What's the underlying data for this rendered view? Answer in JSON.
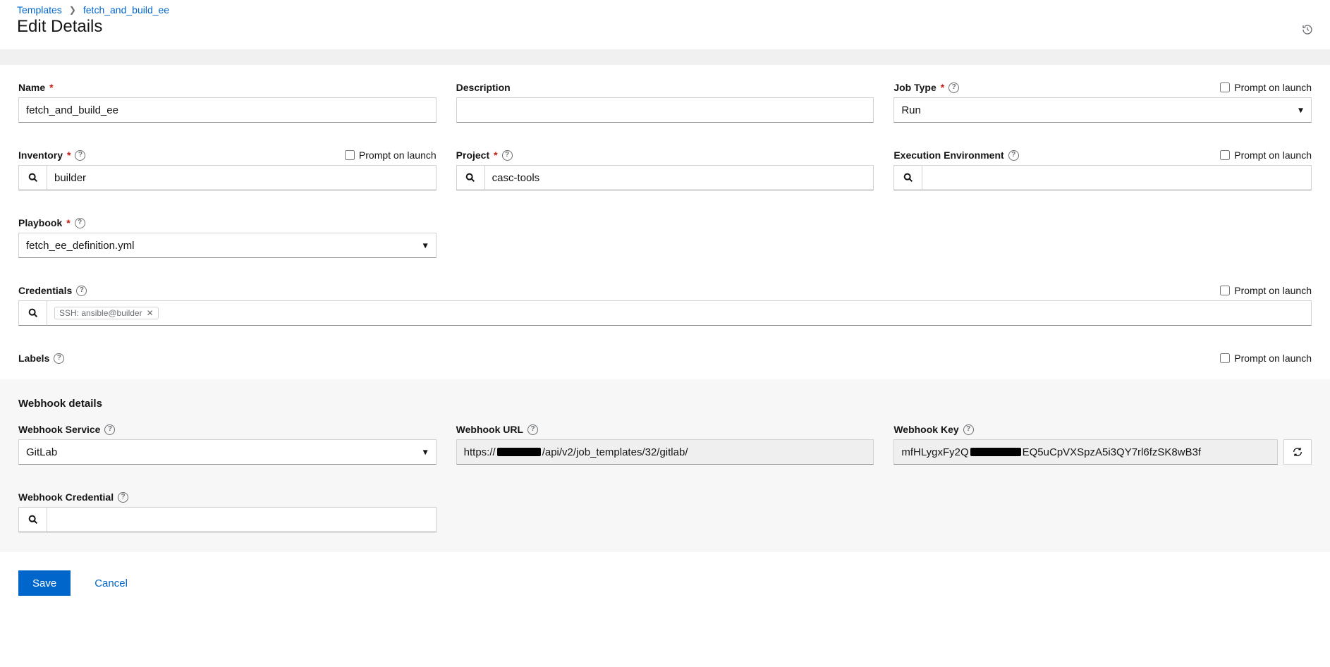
{
  "breadcrumb": {
    "root": "Templates",
    "current": "fetch_and_build_ee"
  },
  "page": {
    "title": "Edit Details"
  },
  "labels": {
    "name": "Name",
    "description": "Description",
    "job_type": "Job Type",
    "inventory": "Inventory",
    "project": "Project",
    "exec_env": "Execution Environment",
    "playbook": "Playbook",
    "credentials": "Credentials",
    "labels_lbl": "Labels",
    "prompt": "Prompt on launch",
    "webhook_section": "Webhook details",
    "webhook_service": "Webhook Service",
    "webhook_url": "Webhook URL",
    "webhook_key": "Webhook Key",
    "webhook_credential": "Webhook Credential",
    "save": "Save",
    "cancel": "Cancel"
  },
  "values": {
    "name": "fetch_and_build_ee",
    "description": "",
    "job_type": "Run",
    "inventory": "builder",
    "project": "casc-tools",
    "exec_env": "",
    "playbook": "fetch_ee_definition.yml",
    "credential_chip": "SSH: ansible@builder",
    "webhook_service": "GitLab",
    "webhook_url_prefix": "https://",
    "webhook_url_suffix": "/api/v2/job_templates/32/gitlab/",
    "webhook_key_prefix": "mfHLygxFy2Q",
    "webhook_key_suffix": "EQ5uCpVXSpzA5i3QY7rl6fzSK8wB3f"
  }
}
